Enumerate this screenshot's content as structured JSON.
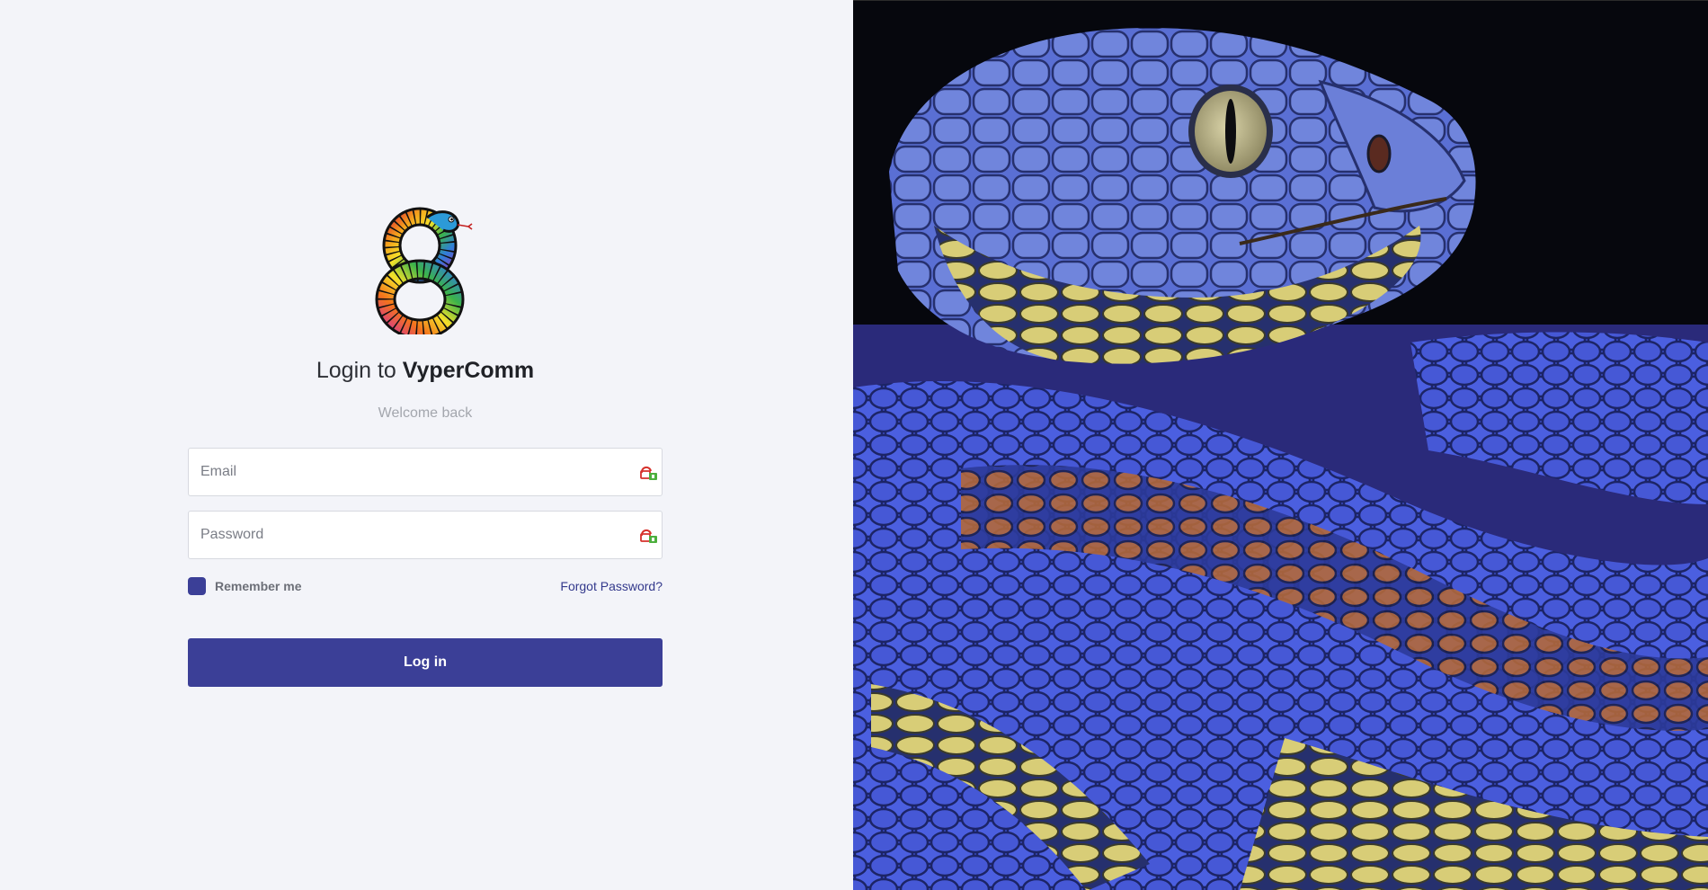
{
  "brand": {
    "logo_icon": "rainbow-snake-figure-eight-icon",
    "title_prefix": "Login to",
    "title_name": "VyperComm"
  },
  "form": {
    "subtitle": "Welcome back",
    "email_placeholder": "Email",
    "email_value": "",
    "email_autofill_icon": "password-manager-icon",
    "password_placeholder": "Password",
    "password_value": "",
    "password_autofill_icon": "password-manager-icon",
    "remember_label": "Remember me",
    "remember_checked": true,
    "forgot_label": "Forgot Password?",
    "login_label": "Log in"
  },
  "hero": {
    "image": "blue-viper-snake-closeup",
    "colors": {
      "scales": "#3f52cf",
      "belly": "#d9cf7a",
      "accent_rust": "#b56a3a",
      "background": "#05060c"
    }
  },
  "theme": {
    "primary": "#3b3f97",
    "page_background": "#f3f4f9"
  }
}
